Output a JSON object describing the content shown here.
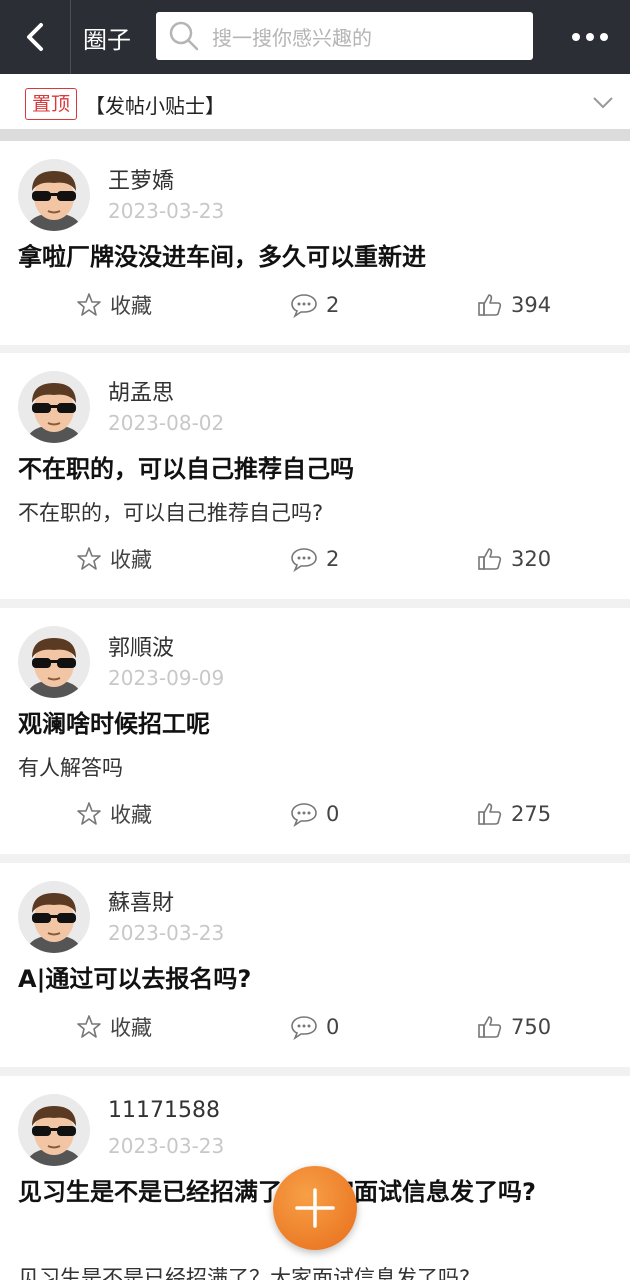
{
  "header": {
    "title": "圈子",
    "search_placeholder": "搜一搜你感兴趣的"
  },
  "pinned": {
    "badge": "置顶",
    "text": "【发帖小贴士】"
  },
  "actions": {
    "favorite_label": "收藏"
  },
  "posts": [
    {
      "user": "王萝嬌",
      "date": "2023-03-23",
      "title": "拿啦厂牌没没进车间，多久可以重新进",
      "body": "",
      "comments": "2",
      "likes": "394"
    },
    {
      "user": "胡孟思",
      "date": "2023-08-02",
      "title": "不在职的，可以自己推荐自己吗",
      "body": "不在职的，可以自己推荐自己吗?",
      "comments": "2",
      "likes": "320"
    },
    {
      "user": "郭順波",
      "date": "2023-09-09",
      "title": "观澜啥时候招工呢",
      "body": "有人解答吗",
      "comments": "0",
      "likes": "275"
    },
    {
      "user": "蘇喜財",
      "date": "2023-03-23",
      "title": "A|通过可以去报名吗?",
      "body": "",
      "comments": "0",
      "likes": "750"
    },
    {
      "user": "11171588",
      "date": "2023-03-23",
      "title": "见习生是不是已经招满了？大家面试信息发了吗?",
      "body": "见习生是不是已经招满了？大家面试信息发了吗?",
      "comments": "",
      "likes": ""
    }
  ]
}
